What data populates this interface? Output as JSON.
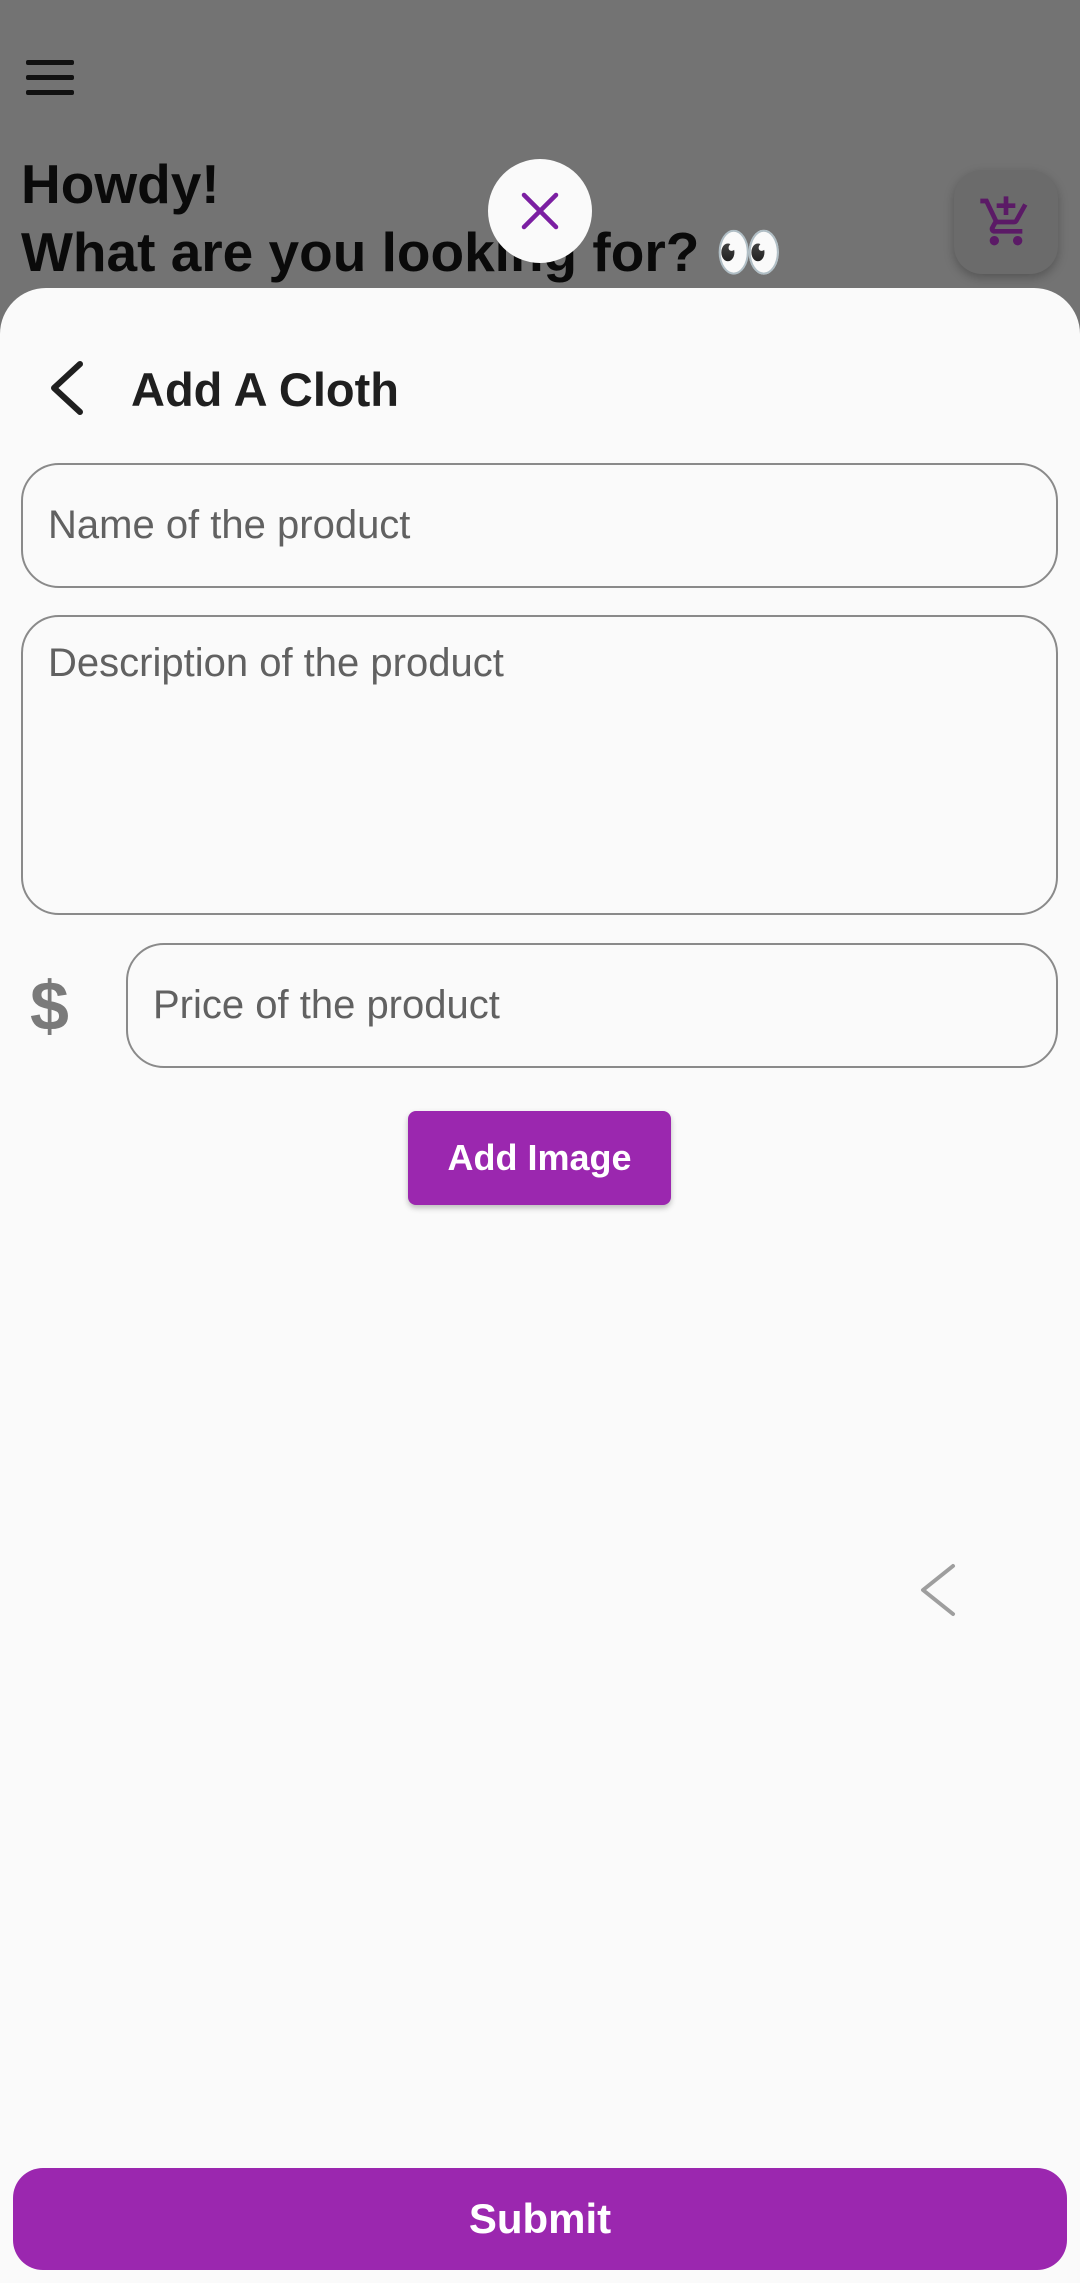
{
  "header": {
    "greeting_line1": "Howdy!",
    "greeting_line2": "What are you looking for? 👀",
    "menu_icon": "hamburger-menu-icon",
    "cart_icon": "cart-add-icon"
  },
  "modal": {
    "close_icon": "close-icon",
    "title": "Add A Cloth",
    "back_icon": "chevron-left-icon"
  },
  "form": {
    "name_placeholder": "Name of the product",
    "description_placeholder": "Description of the product",
    "currency_symbol": "$",
    "price_placeholder": "Price of the product",
    "add_image_label": "Add Image",
    "submit_label": "Submit"
  },
  "colors": {
    "accent": "#9b27af",
    "overlay": "#737373",
    "sheet_bg": "#fafafa"
  }
}
